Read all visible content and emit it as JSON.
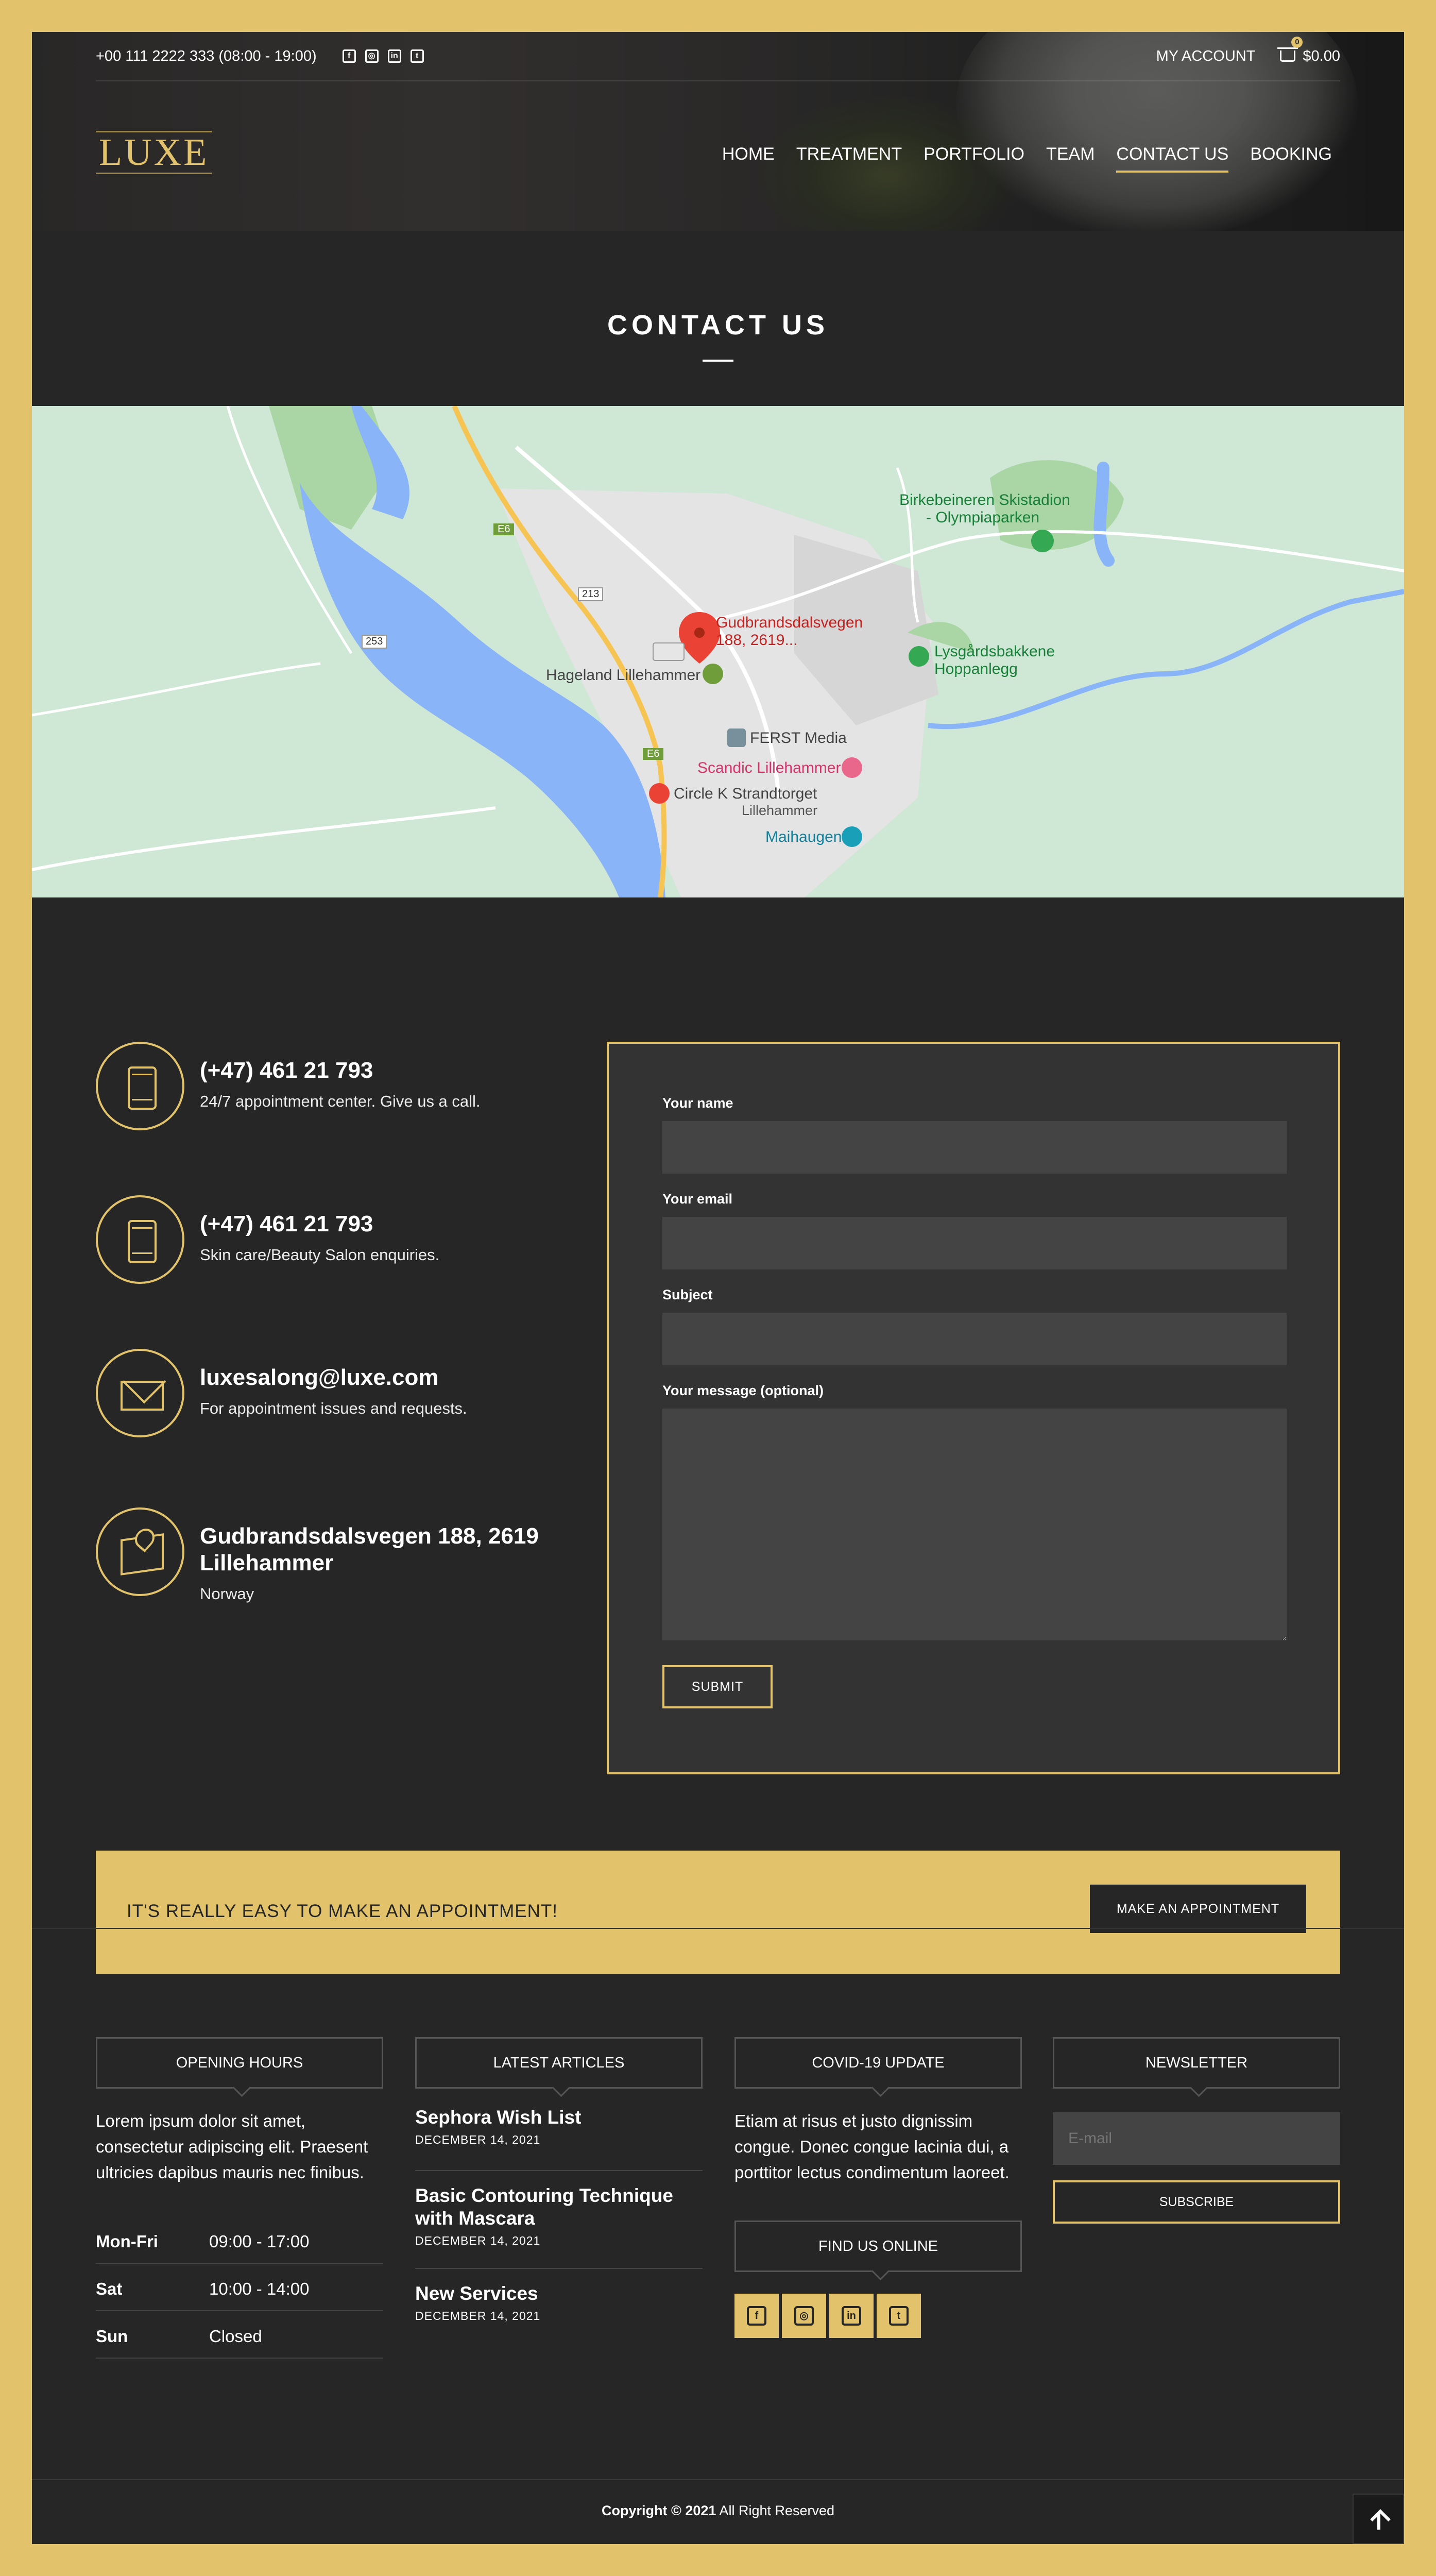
{
  "topbar": {
    "phone": "+00 111 2222 333 (08:00 - 19:00)",
    "social": [
      "facebook-icon",
      "instagram-icon",
      "linkedin-icon",
      "twitter-icon"
    ],
    "my_account": "MY ACCOUNT",
    "cart_count": "0",
    "cart_total": "$0.00"
  },
  "logo": "LUXE",
  "nav": {
    "items": [
      {
        "label": "HOME"
      },
      {
        "label": "TREATMENT"
      },
      {
        "label": "PORTFOLIO"
      },
      {
        "label": "TEAM"
      },
      {
        "label": "CONTACT US"
      },
      {
        "label": "BOOKING"
      }
    ],
    "active": "CONTACT US"
  },
  "page_title": "CONTACT US",
  "map": {
    "place_labels": [
      "Gudbrandsdalsvegen",
      "188, 2619...",
      "Birkebeineren Skistadion",
      "- Olympiaparken",
      "Lysgårdsbakkene",
      "Hoppanlegg",
      "Hageland Lillehammer",
      "FERST Media",
      "Scandic Lillehammer",
      "Circle K Strandtorget",
      "Lillehammer",
      "Maihaugen"
    ],
    "road_labels": [
      "E6",
      "213",
      "253",
      "E6"
    ]
  },
  "contact": {
    "items": [
      {
        "icon": "mobile-icon",
        "title": "(+47) 461 21 793",
        "sub": "24/7 appointment center. Give us a call."
      },
      {
        "icon": "mobile-icon",
        "title": "(+47) 461 21 793",
        "sub": "Skin care/Beauty Salon enquiries."
      },
      {
        "icon": "envelope-icon",
        "title": "luxesalong@luxe.com",
        "sub": "For appointment issues and requests."
      },
      {
        "icon": "map-pin-icon",
        "title": "Gudbrandsdalsvegen 188, 2619 Lillehammer",
        "sub": "Norway"
      }
    ],
    "form": {
      "name_label": "Your name",
      "email_label": "Your email",
      "subject_label": "Subject",
      "message_label": "Your message (optional)",
      "submit": "SUBMIT"
    }
  },
  "appointment": {
    "text": "IT'S REALLY EASY TO MAKE AN APPOINTMENT!",
    "button": "MAKE AN APPOINTMENT"
  },
  "footer": {
    "hours": {
      "title": "OPENING HOURS",
      "text": "Lorem ipsum dolor sit amet, consectetur adipiscing elit. Praesent ultricies dapibus mauris nec finibus.",
      "rows": [
        {
          "day": "Mon-Fri",
          "time": "09:00 - 17:00"
        },
        {
          "day": "Sat",
          "time": "10:00 - 14:00"
        },
        {
          "day": "Sun",
          "time": "Closed"
        }
      ]
    },
    "articles": {
      "title": "LATEST ARTICLES",
      "items": [
        {
          "title": "Sephora Wish List",
          "date": "DECEMBER 14, 2021"
        },
        {
          "title": "Basic Contouring Technique with Mascara",
          "date": "DECEMBER 14, 2021"
        },
        {
          "title": "New Services",
          "date": "DECEMBER 14, 2021"
        }
      ]
    },
    "covid": {
      "title": "COVID-19 UPDATE",
      "text": "Etiam at risus et justo dignissim congue. Donec congue lacinia dui, a porttitor lectus condimentum laoreet.",
      "find_title": "FIND US ONLINE",
      "social": [
        "facebook-icon",
        "instagram-icon",
        "linkedin-icon",
        "twitter-icon"
      ]
    },
    "newsletter": {
      "title": "NEWSLETTER",
      "placeholder": "E-mail",
      "button": "SUBSCRIBE"
    }
  },
  "copyright": {
    "bold": "Copyright © 2021",
    "rest": " All Right Reserved"
  },
  "colors": {
    "accent": "#e2c36c",
    "dark": "#262626",
    "input": "#444444"
  }
}
